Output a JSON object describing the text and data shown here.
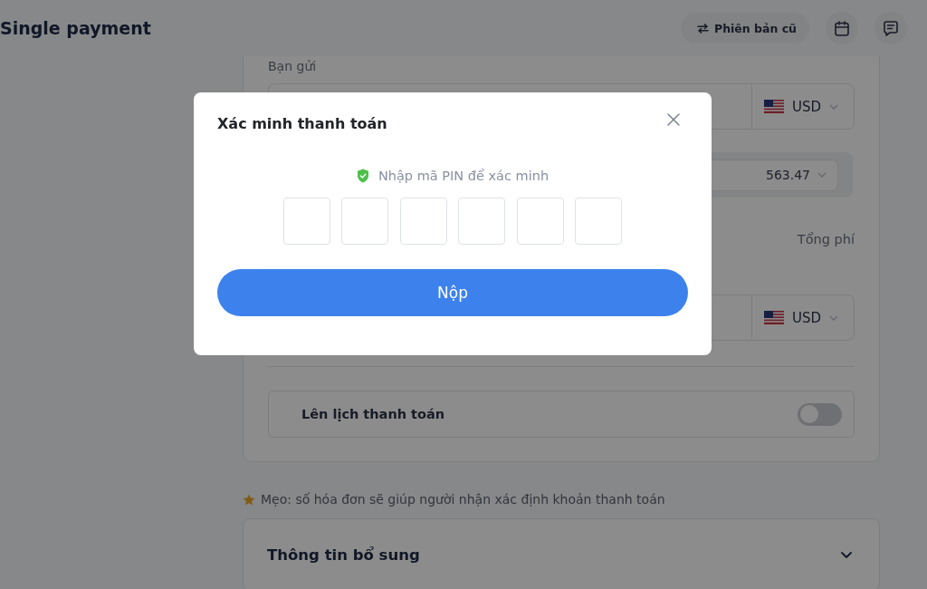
{
  "header": {
    "title": "Single payment",
    "old_version_button": "Phiên bản cũ"
  },
  "form": {
    "send_label": "Bạn gửi",
    "send_currency": "USD",
    "rate_value": "563.47",
    "fee_label": "Tổng phí",
    "receive_currency": "USD",
    "schedule": {
      "label": "Lên lịch thanh toán",
      "on": false
    }
  },
  "tip": "Mẹo: số hóa đơn sẽ giúp người nhận xác định khoản thanh toán",
  "additional_info": {
    "title": "Thông tin bổ sung",
    "expanded": false
  },
  "dialog": {
    "title": "Xác minh thanh toán",
    "hint": "Nhập mã PIN để xác minh",
    "pin_fields": [
      {
        "filled": false
      },
      {
        "filled": false
      },
      {
        "filled": false
      },
      {
        "filled": false
      },
      {
        "filled": false
      },
      {
        "filled": false
      }
    ],
    "submit_button": "Nộp"
  }
}
